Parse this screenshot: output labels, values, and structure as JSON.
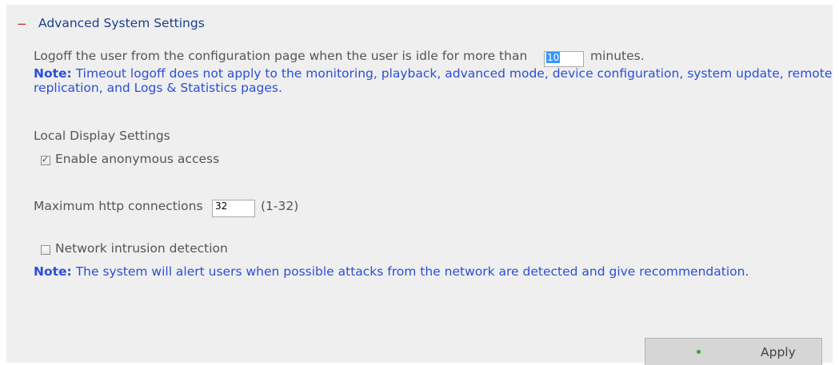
{
  "section": {
    "toggle": "−",
    "title": "Advanced System Settings"
  },
  "idle": {
    "prefix": "Logoff the user from the configuration page when the user is idle for more than",
    "value": "10",
    "suffix": "minutes."
  },
  "timeout_note": {
    "label": "Note:",
    "line1": "Timeout logoff does not apply to the monitoring, playback, advanced mode, device configuration, system update, remote",
    "line2": "replication, and Logs & Statistics pages."
  },
  "local_display": {
    "heading": "Local Display Settings",
    "anonymous_label": "Enable anonymous access",
    "anonymous_checked": true
  },
  "http": {
    "label": "Maximum http connections",
    "value": "32",
    "range": "(1-32)"
  },
  "intrusion": {
    "label": "Network intrusion detection",
    "checked": false,
    "note_label": "Note:",
    "note_text": "The system will alert users when possible attacks from the network are detected and give recommendation."
  },
  "apply": {
    "label": "Apply",
    "indicator_color": "#2eaa2e"
  },
  "colors": {
    "panel_bg": "#efefef",
    "title": "#1a3f8f",
    "note": "#2b4fd8",
    "toggle": "#cc2222"
  }
}
